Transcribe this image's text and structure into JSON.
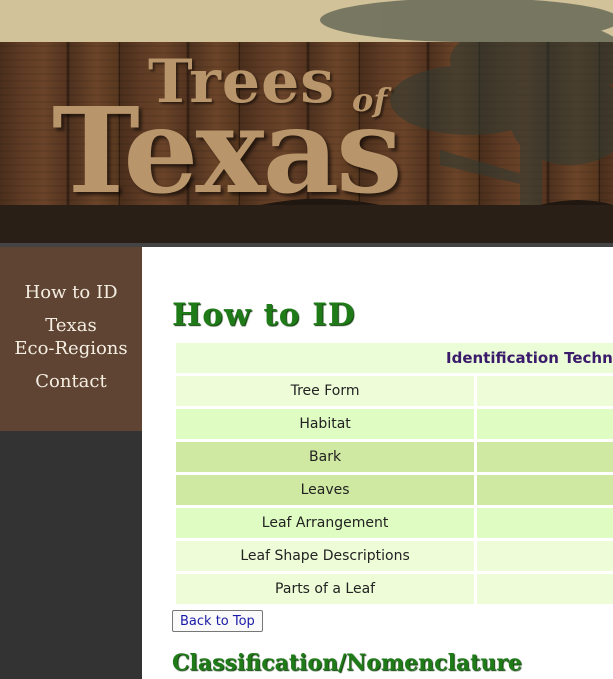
{
  "site": {
    "logo_trees": "Trees",
    "logo_of": "of",
    "logo_texas": "Texas"
  },
  "nav": {
    "how_to_id": "How to ID",
    "texas": "Texas",
    "eco_regions": "Eco-Regions",
    "contact": "Contact"
  },
  "main": {
    "title": "How to ID",
    "table_caption": "Identification Techni",
    "rows": [
      "Tree Form",
      "Habitat",
      "Bark",
      "Leaves",
      "Leaf Arrangement",
      "Leaf Shape Descriptions",
      "Parts of a Leaf"
    ],
    "back_to_top": "Back to Top",
    "section2_title": "Classification/Nomenclature"
  },
  "colors": {
    "heading_green": "#1f7a18",
    "caption_purple": "#3a1a6b",
    "sidebar_brown": "#5f4433",
    "row_light": "#eefdd8",
    "row_mid": "#dffcc2",
    "row_dark": "#cfe9a2"
  }
}
